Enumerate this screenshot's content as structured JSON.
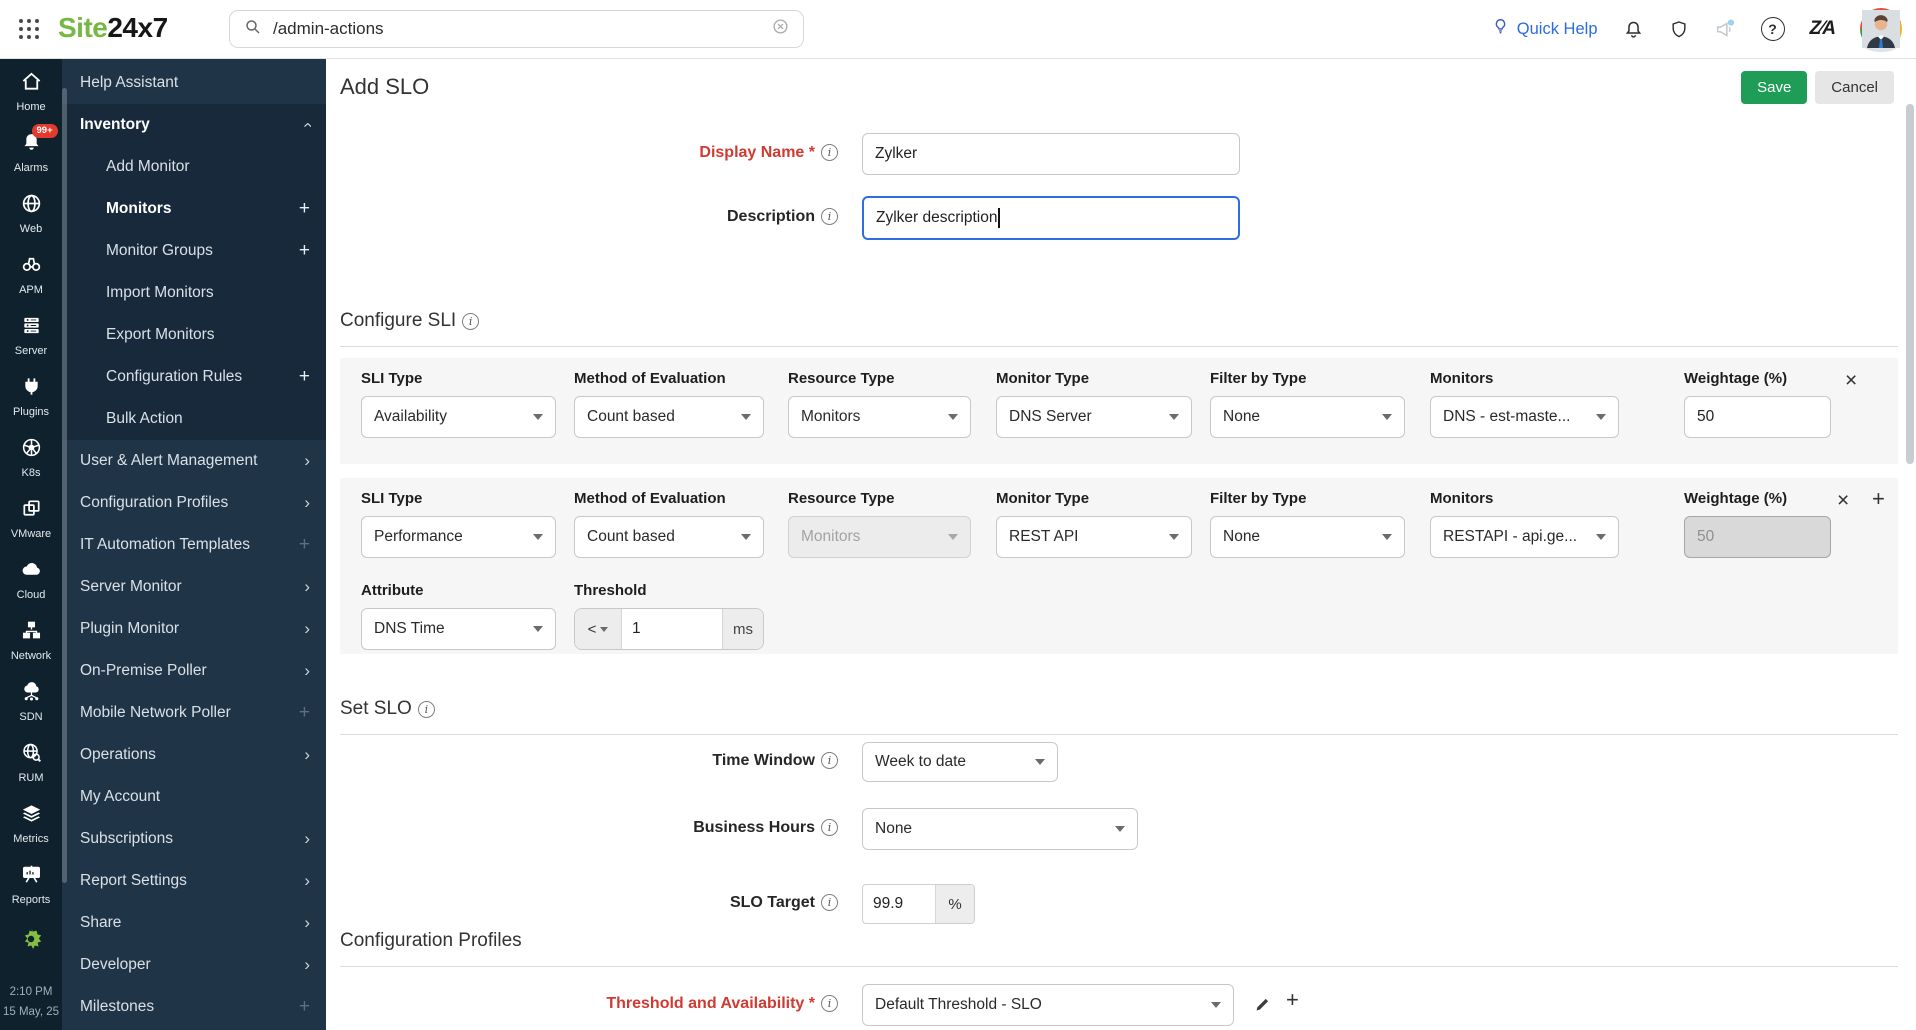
{
  "colors": {
    "brand_green": "#76b843",
    "save_green": "#1f9d57",
    "required_red": "#d13a31",
    "focus_blue": "#2e6de4",
    "alarm_badge_red": "#e23b2e",
    "rail_bg": "#0f212d",
    "sidebar_bg": "#203447"
  },
  "topbar": {
    "logo_part1": "Site",
    "logo_part2": "24x7",
    "search_value": "/admin-actions",
    "quick_help_label": "Quick Help"
  },
  "rail": {
    "items": [
      {
        "label": "Home",
        "icon": "home-icon"
      },
      {
        "label": "Alarms",
        "icon": "bell-icon",
        "badge": "99+"
      },
      {
        "label": "Web",
        "icon": "globe-icon"
      },
      {
        "label": "APM",
        "icon": "binoculars-icon"
      },
      {
        "label": "Server",
        "icon": "server-stack-icon"
      },
      {
        "label": "Plugins",
        "icon": "plug-icon"
      },
      {
        "label": "K8s",
        "icon": "kubernetes-icon"
      },
      {
        "label": "VMware",
        "icon": "overlapping-squares-icon"
      },
      {
        "label": "Cloud",
        "icon": "cloud-icon"
      },
      {
        "label": "Network",
        "icon": "network-topology-icon"
      },
      {
        "label": "SDN",
        "icon": "cloud-network-icon"
      },
      {
        "label": "RUM",
        "icon": "globe-magnifier-icon"
      },
      {
        "label": "Metrics",
        "icon": "layers-icon"
      },
      {
        "label": "Reports",
        "icon": "presentation-icon"
      }
    ],
    "admin_icon": "gear-icon",
    "time": "2:10 PM",
    "date": "15 May, 25"
  },
  "sidebar": {
    "items": [
      {
        "label": "Help Assistant",
        "trailing": "none"
      },
      {
        "label": "Inventory",
        "trailing": "chevron-up",
        "emphasis": true,
        "active_section": true
      },
      {
        "label": "Add Monitor",
        "indent": true,
        "trailing": "none"
      },
      {
        "label": "Monitors",
        "indent": true,
        "trailing": "plus",
        "emphasis": true
      },
      {
        "label": "Monitor Groups",
        "indent": true,
        "trailing": "plus"
      },
      {
        "label": "Import Monitors",
        "indent": true,
        "trailing": "none"
      },
      {
        "label": "Export Monitors",
        "indent": true,
        "trailing": "none"
      },
      {
        "label": "Configuration Rules",
        "indent": true,
        "trailing": "plus"
      },
      {
        "label": "Bulk Action",
        "indent": true,
        "trailing": "none"
      },
      {
        "label": "User & Alert Management",
        "trailing": "chevron-right"
      },
      {
        "label": "Configuration Profiles",
        "trailing": "chevron-right"
      },
      {
        "label": "IT Automation Templates",
        "trailing": "plus-dim"
      },
      {
        "label": "Server Monitor",
        "trailing": "chevron-right"
      },
      {
        "label": "Plugin Monitor",
        "trailing": "chevron-right"
      },
      {
        "label": "On-Premise Poller",
        "trailing": "chevron-right"
      },
      {
        "label": "Mobile Network Poller",
        "trailing": "plus-dim"
      },
      {
        "label": "Operations",
        "trailing": "chevron-right"
      },
      {
        "label": "My Account",
        "trailing": "none"
      },
      {
        "label": "Subscriptions",
        "trailing": "chevron-right"
      },
      {
        "label": "Report Settings",
        "trailing": "chevron-right"
      },
      {
        "label": "Share",
        "trailing": "chevron-right"
      },
      {
        "label": "Developer",
        "trailing": "chevron-right"
      },
      {
        "label": "Milestones",
        "trailing": "plus-dim"
      }
    ]
  },
  "page": {
    "title": "Add SLO",
    "save_label": "Save",
    "cancel_label": "Cancel"
  },
  "form": {
    "display_name_label": "Display Name *",
    "display_name_value": "Zylker",
    "description_label": "Description",
    "description_value": "Zylker description"
  },
  "configure_sli": {
    "heading": "Configure SLI",
    "col_labels": {
      "sli_type": "SLI Type",
      "method": "Method of Evaluation",
      "resource_type": "Resource Type",
      "monitor_type": "Monitor Type",
      "filter_by": "Filter by Type",
      "monitors": "Monitors",
      "weightage": "Weightage (%)",
      "attribute": "Attribute",
      "threshold": "Threshold"
    },
    "rows": [
      {
        "sli_type": "Availability",
        "method": "Count based",
        "resource_type": "Monitors",
        "monitor_type": "DNS Server",
        "filter_by": "None",
        "monitors": "DNS - est-maste...",
        "weightage": "50"
      },
      {
        "sli_type": "Performance",
        "method": "Count based",
        "resource_type": "Monitors",
        "monitor_type": "REST API",
        "filter_by": "None",
        "monitors": "RESTAPI - api.ge...",
        "weightage": "50",
        "attribute": "DNS Time",
        "threshold_op": "<",
        "threshold_value": "1",
        "threshold_unit": "ms"
      }
    ]
  },
  "set_slo": {
    "heading": "Set SLO",
    "time_window_label": "Time Window",
    "time_window_value": "Week to date",
    "business_hours_label": "Business Hours",
    "business_hours_value": "None",
    "slo_target_label": "SLO Target",
    "slo_target_value": "99.9",
    "slo_target_unit": "%"
  },
  "configuration_profiles": {
    "heading": "Configuration Profiles",
    "threshold_label": "Threshold and Availability *",
    "threshold_value": "Default Threshold - SLO"
  }
}
